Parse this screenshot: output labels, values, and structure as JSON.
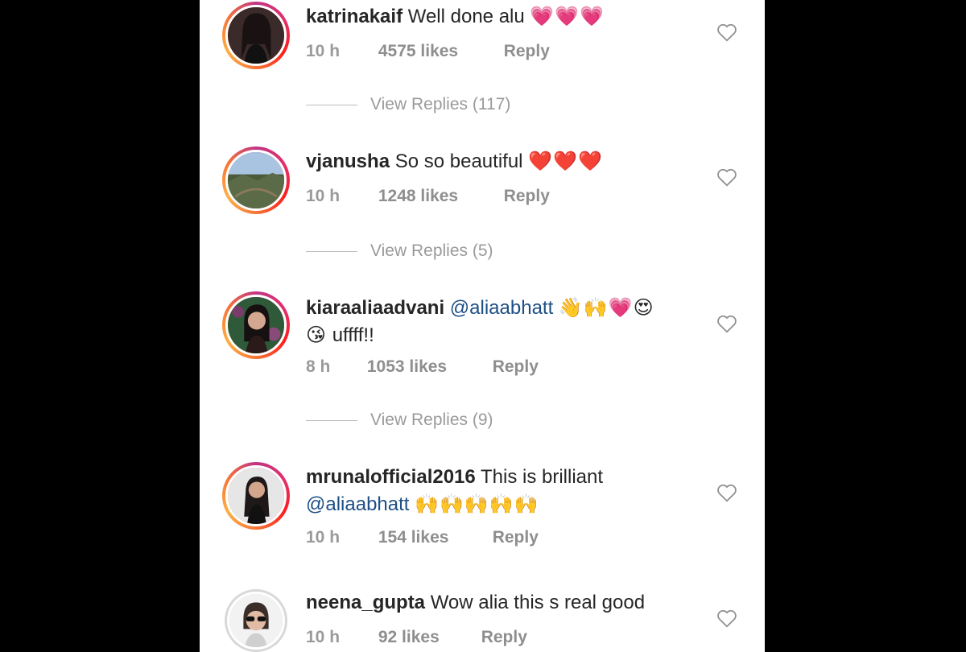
{
  "comments": [
    {
      "username": "katrinakaif",
      "text": "Well done alu",
      "emojis": "💗💗💗",
      "time": "10 h",
      "likes": "4575 likes",
      "reply": "Reply",
      "view_replies": "View Replies (117)"
    },
    {
      "username": "vjanusha",
      "text": "So so beautiful",
      "emojis": "❤️❤️❤️",
      "time": "10 h",
      "likes": "1248 likes",
      "reply": "Reply",
      "view_replies": "View Replies (5)"
    },
    {
      "username": "kiaraaliaadvani",
      "mention": "@aliaabhatt",
      "emojis": "👋🙌💗😍",
      "emojis_line2": "😘",
      "text": "uffff!!",
      "time": "8 h",
      "likes": "1053 likes",
      "reply": "Reply",
      "view_replies": "View Replies (9)"
    },
    {
      "username": "mrunalofficial2016",
      "text": "This is brilliant",
      "mention": "@aliaabhatt",
      "emojis": "🙌🙌🙌🙌🙌",
      "time": "10 h",
      "likes": "154 likes",
      "reply": "Reply"
    },
    {
      "username": "neena_gupta",
      "text": "Wow alia this s real good",
      "time": "10 h",
      "likes": "92 likes",
      "reply": "Reply"
    }
  ],
  "icons": {
    "like": "heart-outline-icon"
  },
  "colors": {
    "text": "#262626",
    "meta": "#8e8e8e",
    "mention": "#1d4f86",
    "ring_start": "#c13584",
    "ring_end": "#fcaf45"
  }
}
